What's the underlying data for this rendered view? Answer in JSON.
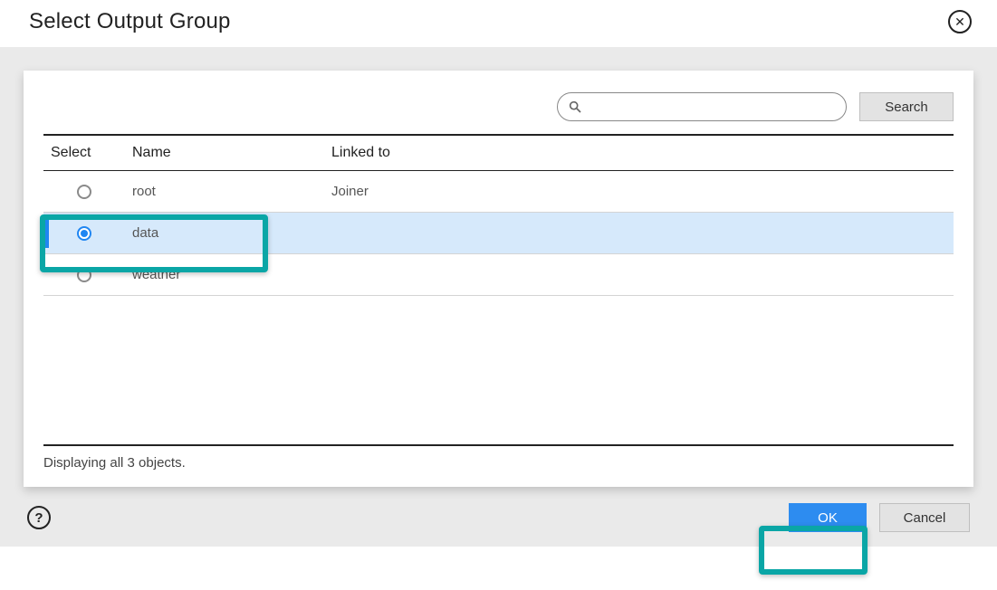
{
  "dialog": {
    "title": "Select Output Group"
  },
  "search": {
    "placeholder": "",
    "button_label": "Search"
  },
  "table": {
    "headers": {
      "select": "Select",
      "name": "Name",
      "linked_to": "Linked to"
    },
    "rows": [
      {
        "name": "root",
        "linked_to": "Joiner",
        "selected": false
      },
      {
        "name": "data",
        "linked_to": "",
        "selected": true
      },
      {
        "name": "weather",
        "linked_to": "",
        "selected": false
      }
    ],
    "status": "Displaying all 3 objects."
  },
  "footer": {
    "ok_label": "OK",
    "cancel_label": "Cancel"
  }
}
